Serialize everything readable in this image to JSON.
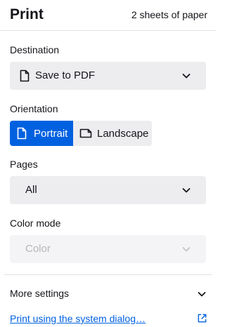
{
  "header": {
    "title": "Print",
    "sheets": "2 sheets of paper"
  },
  "destination": {
    "label": "Destination",
    "value": "Save to PDF",
    "icon": "document-icon"
  },
  "orientation": {
    "label": "Orientation",
    "options": [
      {
        "label": "Portrait",
        "icon": "portrait-page-icon",
        "selected": true
      },
      {
        "label": "Landscape",
        "icon": "landscape-page-icon",
        "selected": false
      }
    ]
  },
  "pages": {
    "label": "Pages",
    "value": "All"
  },
  "color_mode": {
    "label": "Color mode",
    "value": "Color",
    "disabled": true
  },
  "footer": {
    "more_settings": "More settings",
    "system_dialog_link": "Print using the system dialog…",
    "system_dialog_icon": "external-link-icon"
  },
  "colors": {
    "accent": "#0061e0",
    "select_bg": "#ededf0",
    "text": "#15141a",
    "disabled_text": "#b6b6bc"
  }
}
